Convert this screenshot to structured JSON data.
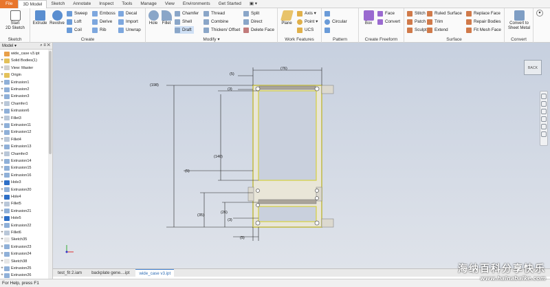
{
  "menu_tabs": [
    "File",
    "3D Model",
    "Sketch",
    "Annotate",
    "Inspect",
    "Tools",
    "Manage",
    "View",
    "Environments",
    "Get Started",
    "▣ ▾"
  ],
  "ribbon": {
    "sketch": {
      "label": "Sketch",
      "start": "Start",
      "start2": "2D Sketch"
    },
    "create": {
      "label": "Create",
      "extrude": "Extrude",
      "revolve": "Revolve",
      "sweep": "Sweep",
      "loft": "Loft",
      "coil": "Coil",
      "emboss": "Emboss",
      "derive": "Derive",
      "rib": "Rib",
      "decal": "Decal",
      "import": "Import",
      "unwrap": "Unwrap"
    },
    "modify": {
      "label": "Modify ▾",
      "hole": "Hole",
      "fillet": "Fillet",
      "chamfer": "Chamfer",
      "shell": "Shell",
      "draft": "Draft",
      "thread": "Thread",
      "combine": "Combine",
      "thicken": "Thicken/ Offset",
      "split": "Split",
      "direct": "Direct",
      "delete_face": "Delete Face"
    },
    "work": {
      "label": "Work Features",
      "plane": "Plane",
      "axis": "Axis ▾",
      "point": "Point ▾",
      "ucs": "UCS"
    },
    "pattern": {
      "label": "Pattern",
      "circular": "Circular"
    },
    "freeform": {
      "label": "Create Freeform",
      "box": "Box",
      "face": "Face",
      "convert": "Convert"
    },
    "surface": {
      "label": "Surface",
      "stitch": "Stitch",
      "patch": "Patch",
      "sculpt": "Sculpt",
      "ruled": "Ruled Surface",
      "trim": "Trim",
      "extend": "Extend",
      "replace": "Replace Face",
      "repair": "Repair Bodies",
      "fitmesh": "Fit Mesh Face"
    },
    "convert": {
      "label": "Convert",
      "btn1": "Convert to",
      "btn2": "Sheet Metal"
    }
  },
  "browser": {
    "header": "Model ▾",
    "header_icons": "⌕ ≡ ✕",
    "items": [
      "wide_case v3.ipt",
      "Solid Bodies(1)",
      "View: Master",
      "Origin",
      "Extrusion1",
      "Extrusion2",
      "Extrusion3",
      "Chamfer1",
      "Extrusion6",
      "Fillet3",
      "Extrusion11",
      "Extrusion12",
      "Fillet4",
      "Extrusion13",
      "Chamfer3",
      "Extrusion14",
      "Extrusion15",
      "Extrusion16",
      "Hole3",
      "Extrusion20",
      "Hole4",
      "Fillet5",
      "Extrusion21",
      "Hole5",
      "Extrusion22",
      "Fillet6",
      "Sketch35",
      "Extrusion23",
      "Extrusion24",
      "Sketch38",
      "Extrusion25",
      "Extrusion26"
    ]
  },
  "dimensions": {
    "d76": "(76)",
    "d5a": "(5)",
    "d198": "(198)",
    "d3a": "(3)",
    "d140": "(140)",
    "d5b": "(5)",
    "d35": "(35)",
    "d26": "(26)",
    "d3b": "(3)",
    "d5c": "(5)"
  },
  "viewcube": "BACK",
  "doc_tabs": [
    "test_fit 2.iam",
    "backplate gene....ipt",
    "wide_case v3.ipt"
  ],
  "status": "For Help, press F1",
  "watermark": {
    "line1": "海纳百科分享快乐",
    "line2": "www.hainabaike.com"
  }
}
